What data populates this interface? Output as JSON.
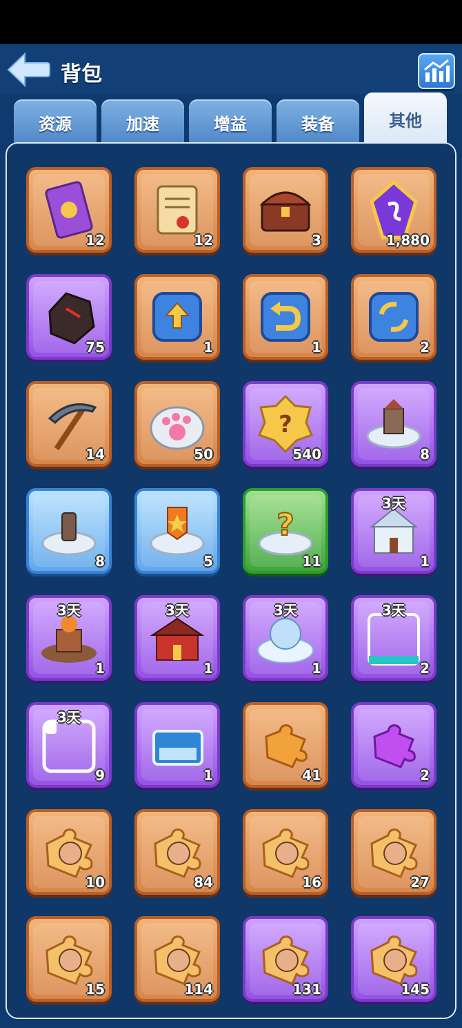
{
  "header": {
    "title": "背包"
  },
  "tabs": [
    {
      "label": "资源",
      "active": false
    },
    {
      "label": "加速",
      "active": false
    },
    {
      "label": "增益",
      "active": false
    },
    {
      "label": "装备",
      "active": false
    },
    {
      "label": "其他",
      "active": true
    }
  ],
  "items": [
    {
      "icon": "purple-card-icon",
      "count": "12",
      "frame": "orange"
    },
    {
      "icon": "scroll-certificate-icon",
      "count": "12",
      "frame": "orange"
    },
    {
      "icon": "treasure-chest-icon",
      "count": "3",
      "frame": "orange"
    },
    {
      "icon": "purple-gem-icon",
      "count": "1,880",
      "frame": "orange"
    },
    {
      "icon": "dark-ore-icon",
      "count": "75",
      "frame": "purple"
    },
    {
      "icon": "upgrade-arrow-icon",
      "count": "1",
      "frame": "orange"
    },
    {
      "icon": "return-arrow-icon",
      "count": "1",
      "frame": "orange"
    },
    {
      "icon": "swap-arrows-icon",
      "count": "2",
      "frame": "orange"
    },
    {
      "icon": "pickaxe-icon",
      "count": "14",
      "frame": "orange"
    },
    {
      "icon": "paw-cookie-icon",
      "count": "50",
      "frame": "orange"
    },
    {
      "icon": "mystery-badge-icon",
      "count": "540",
      "frame": "purple"
    },
    {
      "icon": "relocate-castle-icon",
      "count": "8",
      "frame": "purple"
    },
    {
      "icon": "relocate-statue-icon",
      "count": "8",
      "frame": "blue"
    },
    {
      "icon": "relocate-banner-icon",
      "count": "5",
      "frame": "blue"
    },
    {
      "icon": "random-relocate-icon",
      "count": "11",
      "frame": "green"
    },
    {
      "icon": "gingerbread-house-skin-icon",
      "count": "1",
      "timer": "3天",
      "frame": "purple"
    },
    {
      "icon": "autumn-city-skin-icon",
      "count": "1",
      "timer": "3天",
      "frame": "purple"
    },
    {
      "icon": "palace-city-skin-icon",
      "count": "1",
      "timer": "3天",
      "frame": "purple"
    },
    {
      "icon": "snow-city-skin-icon",
      "count": "1",
      "timer": "3天",
      "frame": "purple"
    },
    {
      "icon": "taptap-frame-icon",
      "count": "2",
      "timer": "3天",
      "frame": "purple"
    },
    {
      "icon": "avatar-frame-icon",
      "count": "9",
      "timer": "3天",
      "frame": "purple"
    },
    {
      "icon": "nameplate-icon",
      "count": "1",
      "frame": "purple"
    },
    {
      "icon": "orange-puzzle-icon",
      "count": "41",
      "frame": "orange"
    },
    {
      "icon": "purple-puzzle-icon",
      "count": "2",
      "frame": "purple"
    },
    {
      "icon": "hero-puzzle-icon",
      "count": "10",
      "frame": "orange"
    },
    {
      "icon": "hero-puzzle-icon",
      "count": "84",
      "frame": "orange"
    },
    {
      "icon": "hero-puzzle-icon",
      "count": "16",
      "frame": "orange"
    },
    {
      "icon": "hero-puzzle-icon",
      "count": "27",
      "frame": "orange"
    },
    {
      "icon": "hero-puzzle-icon",
      "count": "15",
      "frame": "orange"
    },
    {
      "icon": "hero-puzzle-icon",
      "count": "114",
      "frame": "orange"
    },
    {
      "icon": "hero-puzzle-icon",
      "count": "131",
      "frame": "purple"
    },
    {
      "icon": "hero-puzzle-icon",
      "count": "145",
      "frame": "purple"
    }
  ]
}
